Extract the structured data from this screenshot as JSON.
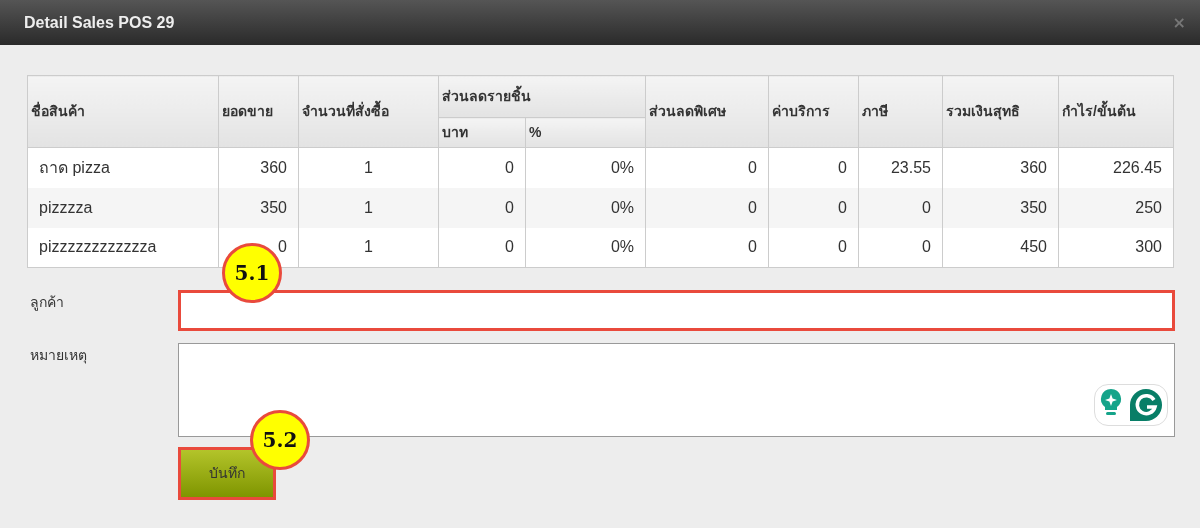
{
  "window": {
    "title": "Detail Sales POS 29",
    "close": "×"
  },
  "table": {
    "column_group": {
      "label": "ส่วนลดรายชิ้น"
    },
    "columns": [
      {
        "label": "ชื่อสินค้า",
        "in_group": false
      },
      {
        "label": "ยอดขาย",
        "in_group": false
      },
      {
        "label": "จำนวนที่สั่งซื้อ",
        "in_group": false
      },
      {
        "label": "บาท",
        "in_group": true
      },
      {
        "label": "%",
        "in_group": true
      },
      {
        "label": "ส่วนลดพิเศษ",
        "in_group": false
      },
      {
        "label": "ค่าบริการ",
        "in_group": false
      },
      {
        "label": "ภาษี",
        "in_group": false
      },
      {
        "label": "รวมเงินสุทธิ",
        "in_group": false
      },
      {
        "label": "กำไร/ขั้นต้น",
        "in_group": false
      }
    ],
    "rows": [
      [
        "ถาด pizza",
        "360",
        "1",
        "0",
        "0%",
        "0",
        "0",
        "23.55",
        "360",
        "226.45"
      ],
      [
        "pizzzza",
        "350",
        "1",
        "0",
        "0%",
        "0",
        "0",
        "0",
        "350",
        "250"
      ],
      [
        "pizzzzzzzzzzzza",
        "0",
        "1",
        "0",
        "0%",
        "0",
        "0",
        "0",
        "450",
        "300"
      ]
    ]
  },
  "form": {
    "customer": {
      "label": "ลูกค้า",
      "highlighted": true
    },
    "note": {
      "label": "หมายเหตุ",
      "highlighted": false
    },
    "save": {
      "label": "บันทึก",
      "highlighted": true
    }
  },
  "callouts": [
    {
      "label": "5.1"
    },
    {
      "label": "5.2"
    }
  ]
}
